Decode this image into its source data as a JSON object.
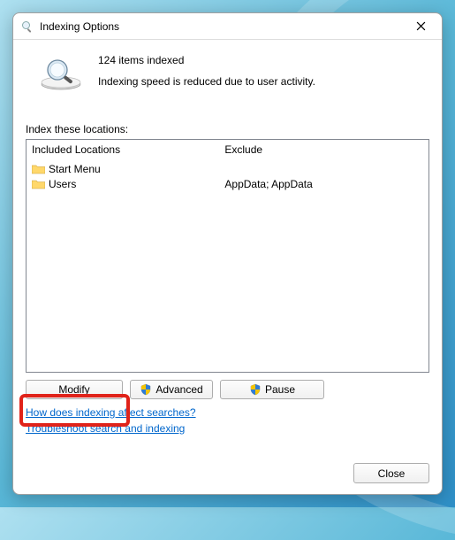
{
  "title": "Indexing Options",
  "status": {
    "count": "124 items indexed",
    "speed": "Indexing speed is reduced due to user activity."
  },
  "section_label": "Index these locations:",
  "columns": {
    "included_header": "Included Locations",
    "exclude_header": "Exclude"
  },
  "locations": [
    {
      "name": "Start Menu",
      "exclude": ""
    },
    {
      "name": "Users",
      "exclude": "AppData; AppData"
    }
  ],
  "buttons": {
    "modify": "Modify",
    "advanced": "Advanced",
    "pause": "Pause",
    "close": "Close"
  },
  "links": {
    "how": "How does indexing affect searches?",
    "troubleshoot": "Troubleshoot search and indexing"
  }
}
